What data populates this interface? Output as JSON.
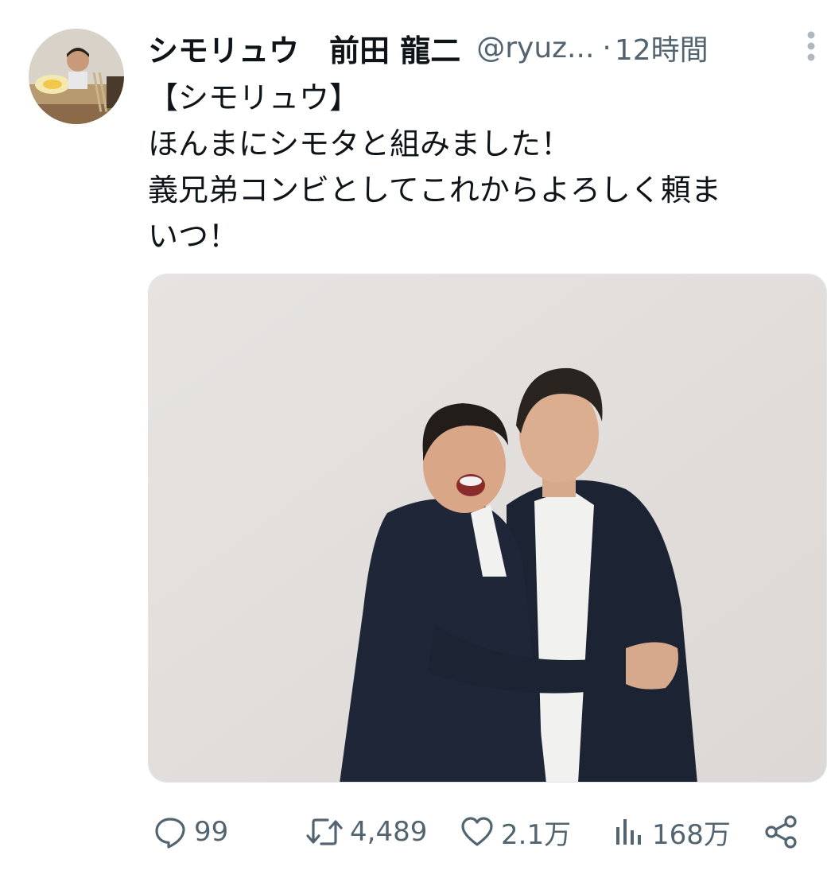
{
  "tweet": {
    "display_name": "シモリュウ　前田 龍二",
    "handle": "@ryuz...",
    "separator": "·",
    "timestamp": "12時間",
    "text_lines": [
      "【シモリュウ】",
      "ほんまにシモタと組みました！",
      "義兄弟コンビとしてこれからよろしく頼ま",
      "いつ！"
    ]
  },
  "actions": {
    "reply": {
      "icon": "reply-icon",
      "count": "99"
    },
    "retweet": {
      "icon": "retweet-icon",
      "count": "4,489"
    },
    "like": {
      "icon": "heart-icon",
      "count": "2.1万"
    },
    "views": {
      "icon": "bar-chart-icon",
      "count": "168万"
    },
    "share": {
      "icon": "share-icon"
    }
  },
  "colors": {
    "text_primary": "#0f1419",
    "text_secondary": "#536471",
    "background": "#ffffff",
    "photo_background": "#e2dfdd",
    "jacket": "#1c2333"
  }
}
